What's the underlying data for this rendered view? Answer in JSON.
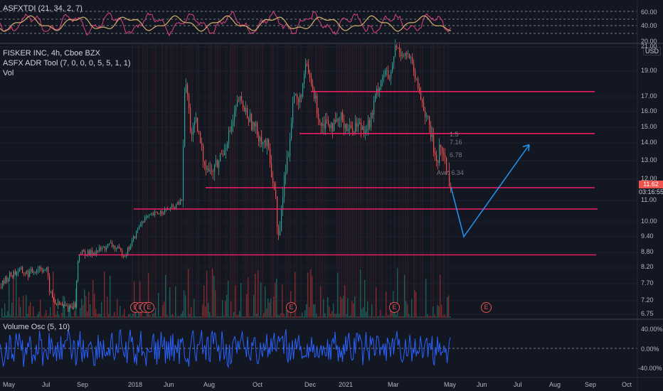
{
  "indicator_top": {
    "title": "ASFXTDI (21, 34, 2, 7)"
  },
  "main": {
    "symbol_line": "FISKER INC, 4h, Cboe BZX",
    "adr_tool": "ASFX ADR Tool (7, 0, 0, 0, 5, 5, 1, 1)",
    "vol_label": "Vol",
    "currency": "USD",
    "last_price": "11.62",
    "countdown": "03:16:55"
  },
  "indicator_bottom": {
    "title": "Volume Osc (5, 10)"
  },
  "adr_labels": [
    "1.5",
    "7.16",
    "6.78",
    "Ave: 6.34"
  ],
  "earnings_marker": "E",
  "top_axis": [
    "60.00",
    "40.00",
    "20.00"
  ],
  "price_axis": [
    "21.00",
    "19.00",
    "17.00",
    "16.00",
    "15.00",
    "14.00",
    "13.00",
    "12.00",
    "11.00",
    "10.00",
    "9.40",
    "8.80",
    "8.20",
    "7.70",
    "7.20",
    "6.75"
  ],
  "osc_axis": [
    "40.00%",
    "0.00%",
    "-40.00%"
  ],
  "time_axis": [
    "May",
    "Jul",
    "Sep",
    "2018",
    "Jun",
    "Aug",
    "Oct",
    "Dec",
    "2021",
    "Mar",
    "May",
    "Jun",
    "Aug",
    "Jul",
    "Sep",
    "Oct"
  ],
  "colors": {
    "bg": "#131722",
    "up": "#26a69a",
    "down": "#ef5350",
    "level": "#e91e63",
    "projection": "#2196f3",
    "osc": "#2962ff",
    "rsi_a": "#e04080",
    "rsi_b": "#d4b06a"
  },
  "chart_data": {
    "type": "line",
    "title": "FISKER INC, 4h, Cboe BZX",
    "y_unit": "USD",
    "horizontal_levels": [
      17.4,
      14.6,
      11.6,
      10.6,
      8.7
    ],
    "projection": [
      {
        "x": "May",
        "y": 11.62
      },
      {
        "x": "Jun",
        "y": 9.4
      },
      {
        "x": "Aug",
        "y": 13.9
      }
    ],
    "last_price": 11.62
  }
}
